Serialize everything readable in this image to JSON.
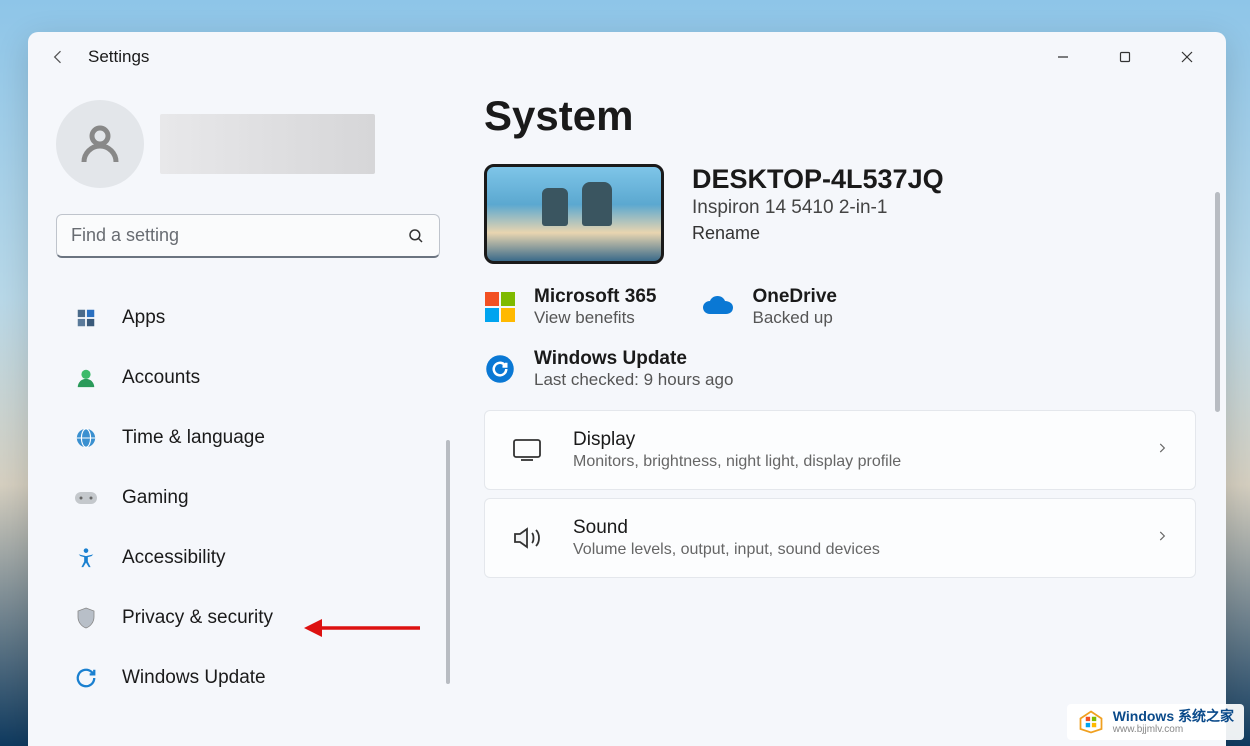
{
  "window": {
    "app_title": "Settings"
  },
  "search": {
    "placeholder": "Find a setting"
  },
  "sidebar": {
    "items": [
      {
        "label": "Apps"
      },
      {
        "label": "Accounts"
      },
      {
        "label": "Time & language"
      },
      {
        "label": "Gaming"
      },
      {
        "label": "Accessibility"
      },
      {
        "label": "Privacy & security"
      },
      {
        "label": "Windows Update"
      }
    ]
  },
  "page": {
    "title": "System",
    "device_name": "DESKTOP-4L537JQ",
    "device_model": "Inspiron 14 5410 2-in-1",
    "rename_label": "Rename"
  },
  "status_cards": {
    "ms365": {
      "title": "Microsoft 365",
      "sub": "View benefits"
    },
    "onedrive": {
      "title": "OneDrive",
      "sub": "Backed up"
    },
    "update": {
      "title": "Windows Update",
      "sub": "Last checked: 9 hours ago"
    }
  },
  "settings": [
    {
      "title": "Display",
      "sub": "Monitors, brightness, night light, display profile"
    },
    {
      "title": "Sound",
      "sub": "Volume levels, output, input, sound devices"
    }
  ],
  "watermark": {
    "main": "Windows 系统之家",
    "sub": "www.bjjmlv.com"
  }
}
